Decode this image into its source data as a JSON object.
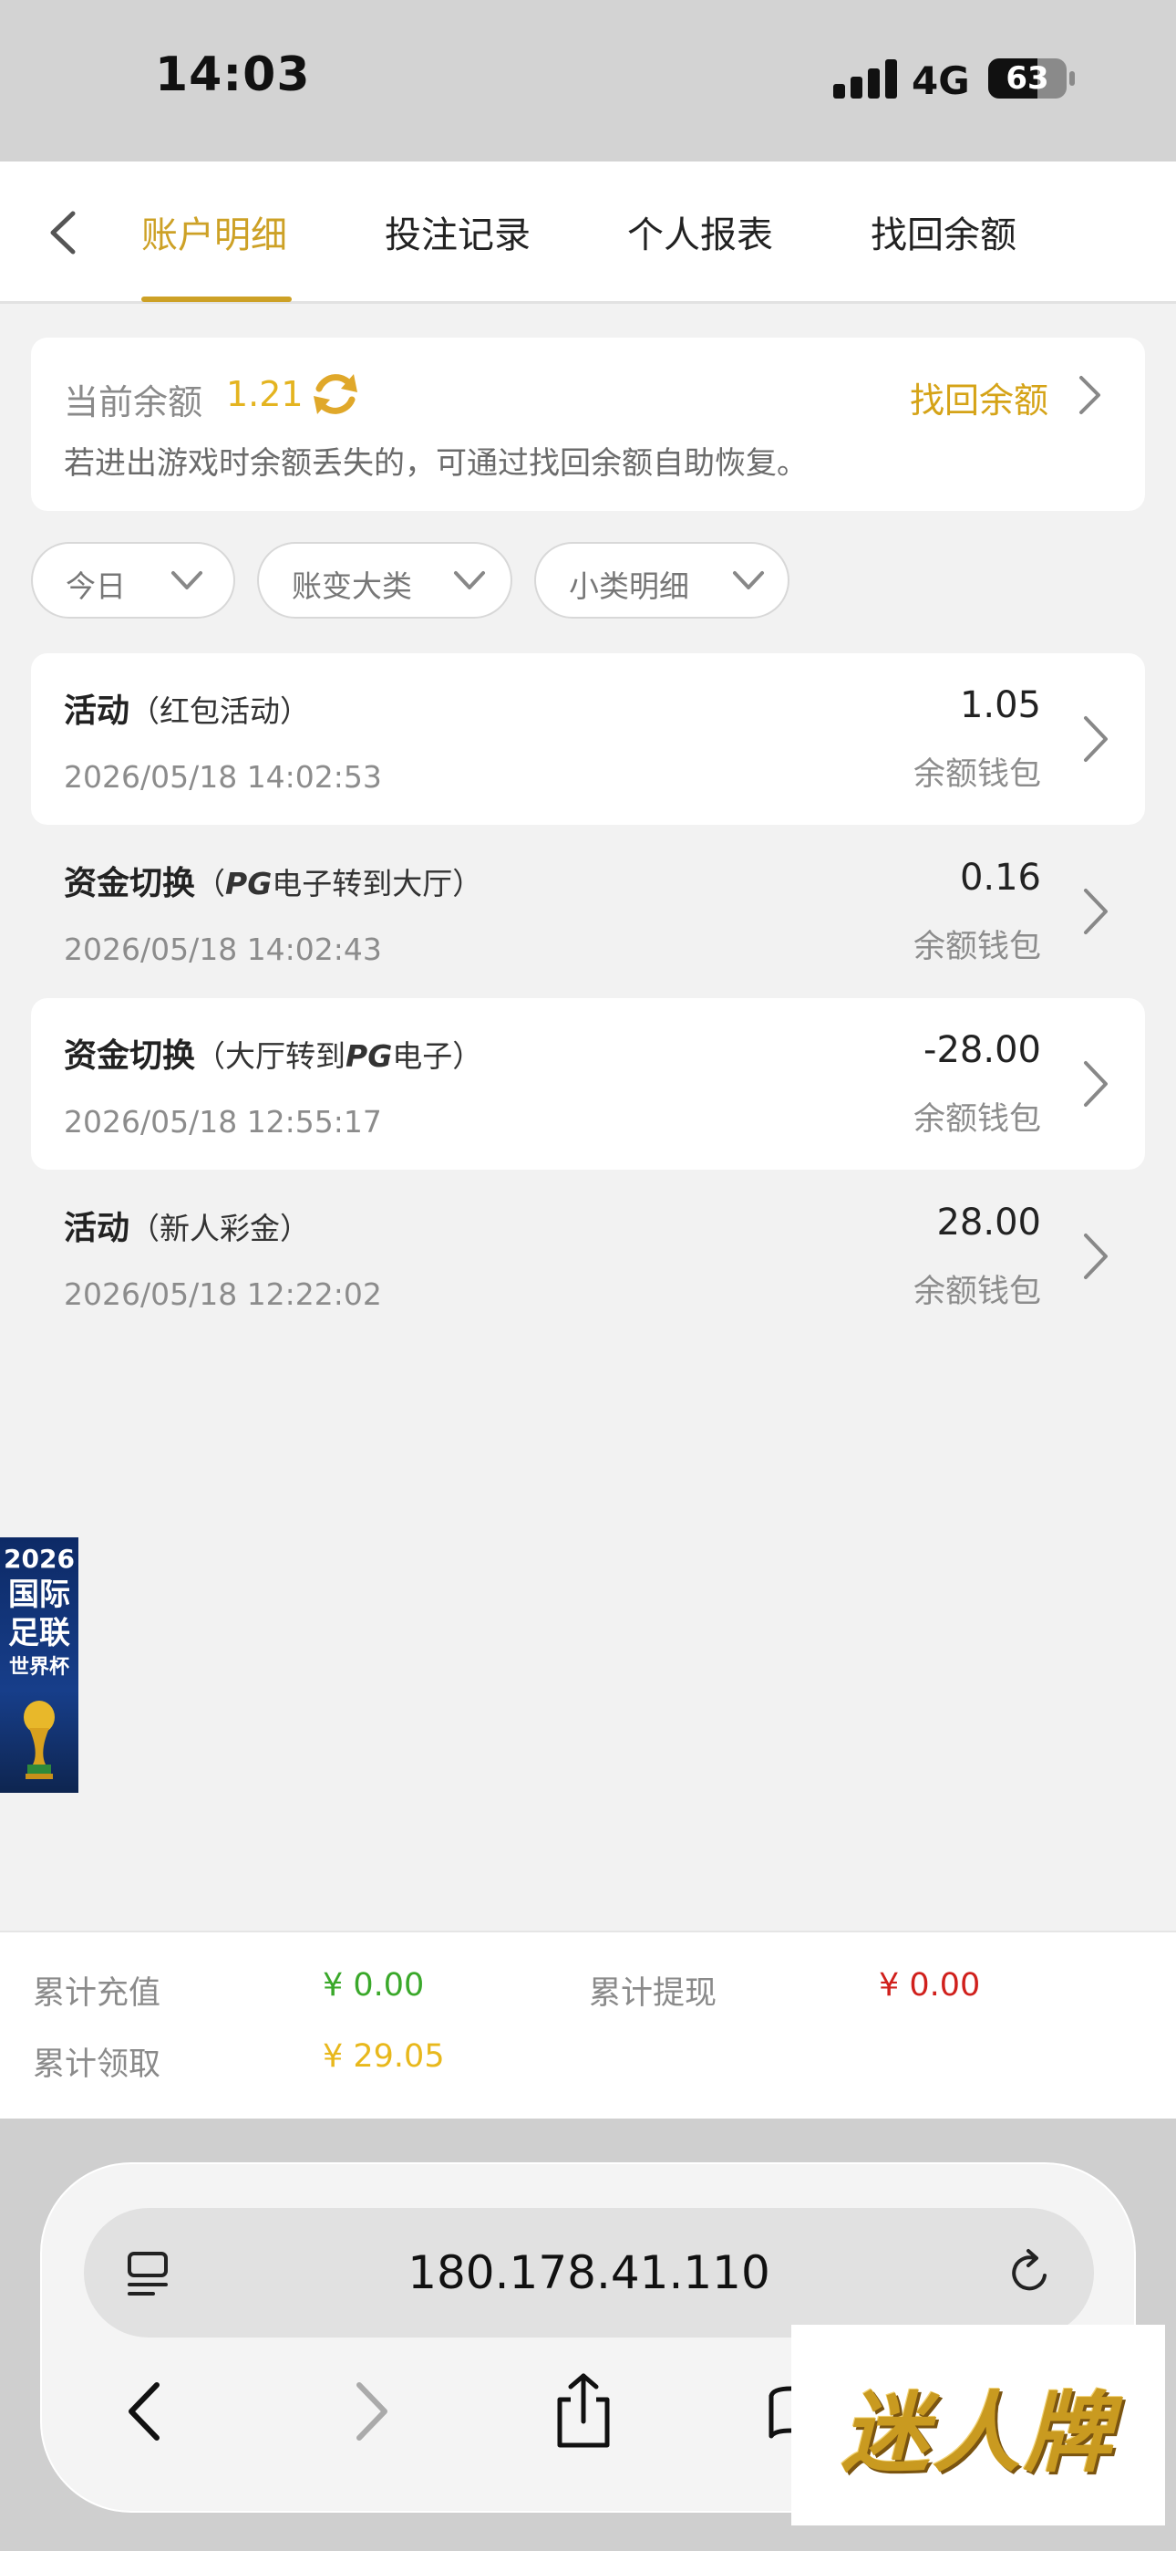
{
  "status_bar": {
    "time": "14:03",
    "network": "4G",
    "battery": "63",
    "battery_level": 0.63
  },
  "header": {
    "tabs": [
      {
        "label": "账户明细",
        "active": true
      },
      {
        "label": "投注记录",
        "active": false
      },
      {
        "label": "个人报表",
        "active": false
      },
      {
        "label": "找回余额",
        "active": false
      }
    ]
  },
  "balance": {
    "label": "当前余额",
    "value": "1.21",
    "recover_label": "找回余额",
    "tip": "若进出游戏时余额丢失的，可通过找回余额自助恢复。"
  },
  "filters": [
    {
      "label": "今日"
    },
    {
      "label": "账变大类"
    },
    {
      "label": "小类明细"
    }
  ],
  "records": [
    {
      "title": "活动",
      "pre": "（红包活动）",
      "brand": "",
      "post": "",
      "amount": "1.05",
      "time": "2026/05/18 14:02:53",
      "wallet": "余额钱包"
    },
    {
      "title": "资金切换",
      "pre": "（",
      "brand": "PG",
      "post": "电子转到大厅）",
      "amount": "0.16",
      "time": "2026/05/18 14:02:43",
      "wallet": "余额钱包"
    },
    {
      "title": "资金切换",
      "pre": "（大厅转到",
      "brand": "PG",
      "post": "电子）",
      "amount": "-28.00",
      "time": "2026/05/18 12:55:17",
      "wallet": "余额钱包"
    },
    {
      "title": "活动",
      "pre": "（新人彩金）",
      "brand": "",
      "post": "",
      "amount": "28.00",
      "time": "2026/05/18 12:22:02",
      "wallet": "余额钱包"
    }
  ],
  "world_cup_banner": {
    "year": "2026",
    "line1": "国际",
    "line2": "足联",
    "line3": "世界杯"
  },
  "summary": {
    "recharge_label": "累计充值",
    "recharge_value": "¥ 0.00",
    "withdraw_label": "累计提现",
    "withdraw_value": "¥ 0.00",
    "claimed_label": "累计领取",
    "claimed_value": "¥ 29.05",
    "colors": {
      "recharge": "#3aa82a",
      "withdraw": "#d0201c",
      "claimed": "#e8b81c"
    }
  },
  "browser": {
    "url": "180.178.41.110"
  },
  "watermark": {
    "text": "迷人牌"
  },
  "colors": {
    "accent": "#cda126"
  }
}
